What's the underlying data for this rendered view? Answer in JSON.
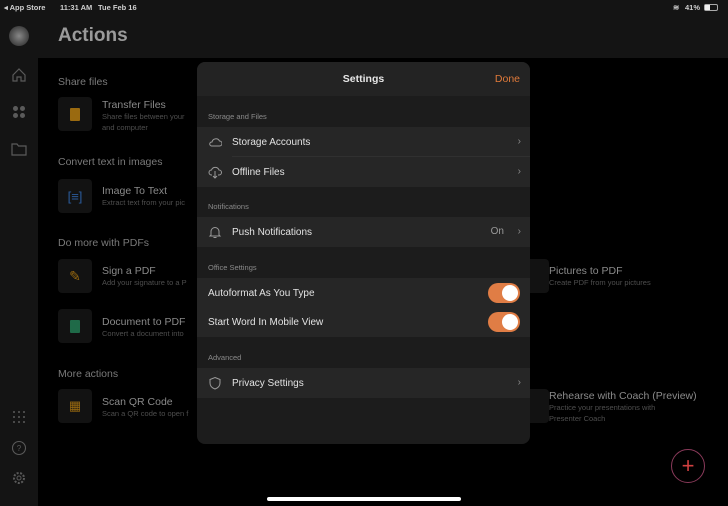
{
  "status_bar": {
    "back_app": "◂ App Store",
    "time": "11:31 AM",
    "date": "Tue Feb 16",
    "battery": "41%"
  },
  "header": {
    "title": "Actions"
  },
  "sections": [
    {
      "title": "Share files",
      "items": [
        {
          "title": "Transfer Files",
          "subtitle": "Share files between your",
          "subtitle2": "and computer"
        }
      ]
    },
    {
      "title": "Convert text in images",
      "items": [
        {
          "title": "Image To Text",
          "subtitle": "Extract text from your pic"
        }
      ]
    },
    {
      "title": "Do more with PDFs",
      "items": [
        {
          "title": "Sign a PDF",
          "subtitle": "Add your signature to a P"
        },
        {
          "title": "Document to PDF",
          "subtitle": "Convert a document into"
        },
        {
          "title": "Pictures to PDF",
          "subtitle": "Create PDF from your pictures"
        }
      ]
    },
    {
      "title": "More actions",
      "items": [
        {
          "title": "Scan QR Code",
          "subtitle": "Scan a QR code to open f"
        },
        {
          "title": "Rehearse with Coach (Preview)",
          "subtitle": "Practice your presentations with",
          "subtitle2": "Presenter Coach"
        }
      ]
    }
  ],
  "settings": {
    "title": "Settings",
    "done": "Done",
    "storage_label": "Storage and Files",
    "storage_accounts": "Storage Accounts",
    "offline_files": "Offline Files",
    "notifications_label": "Notifications",
    "push_notifications": "Push Notifications",
    "push_value": "On",
    "office_label": "Office Settings",
    "autoformat": "Autoformat As You Type",
    "autoformat_on": true,
    "mobile_view": "Start Word In Mobile View",
    "mobile_view_on": true,
    "advanced_label": "Advanced",
    "privacy": "Privacy Settings"
  },
  "colors": {
    "accent": "#e07d45"
  }
}
